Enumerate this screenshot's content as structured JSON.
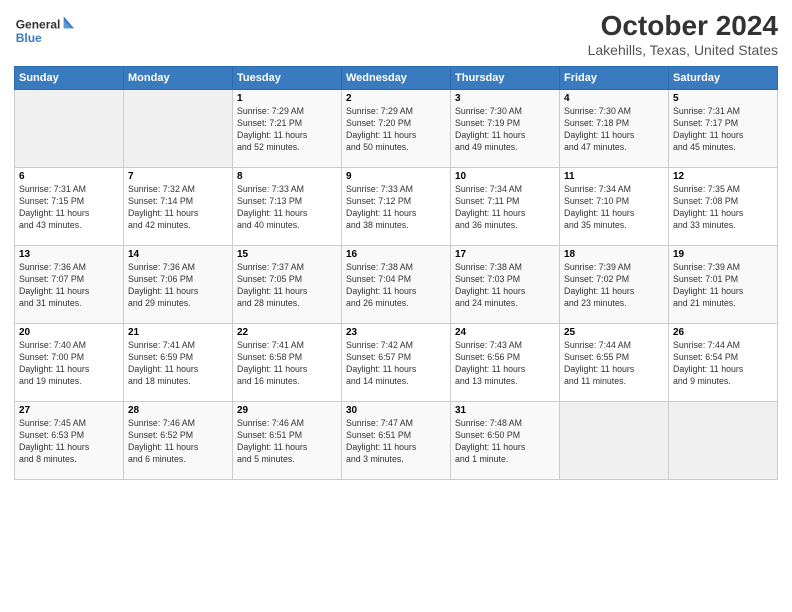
{
  "logo": {
    "line1": "General",
    "line2": "Blue"
  },
  "title": "October 2024",
  "subtitle": "Lakehills, Texas, United States",
  "headers": [
    "Sunday",
    "Monday",
    "Tuesday",
    "Wednesday",
    "Thursday",
    "Friday",
    "Saturday"
  ],
  "weeks": [
    [
      {
        "num": "",
        "info": ""
      },
      {
        "num": "",
        "info": ""
      },
      {
        "num": "1",
        "info": "Sunrise: 7:29 AM\nSunset: 7:21 PM\nDaylight: 11 hours\nand 52 minutes."
      },
      {
        "num": "2",
        "info": "Sunrise: 7:29 AM\nSunset: 7:20 PM\nDaylight: 11 hours\nand 50 minutes."
      },
      {
        "num": "3",
        "info": "Sunrise: 7:30 AM\nSunset: 7:19 PM\nDaylight: 11 hours\nand 49 minutes."
      },
      {
        "num": "4",
        "info": "Sunrise: 7:30 AM\nSunset: 7:18 PM\nDaylight: 11 hours\nand 47 minutes."
      },
      {
        "num": "5",
        "info": "Sunrise: 7:31 AM\nSunset: 7:17 PM\nDaylight: 11 hours\nand 45 minutes."
      }
    ],
    [
      {
        "num": "6",
        "info": "Sunrise: 7:31 AM\nSunset: 7:15 PM\nDaylight: 11 hours\nand 43 minutes."
      },
      {
        "num": "7",
        "info": "Sunrise: 7:32 AM\nSunset: 7:14 PM\nDaylight: 11 hours\nand 42 minutes."
      },
      {
        "num": "8",
        "info": "Sunrise: 7:33 AM\nSunset: 7:13 PM\nDaylight: 11 hours\nand 40 minutes."
      },
      {
        "num": "9",
        "info": "Sunrise: 7:33 AM\nSunset: 7:12 PM\nDaylight: 11 hours\nand 38 minutes."
      },
      {
        "num": "10",
        "info": "Sunrise: 7:34 AM\nSunset: 7:11 PM\nDaylight: 11 hours\nand 36 minutes."
      },
      {
        "num": "11",
        "info": "Sunrise: 7:34 AM\nSunset: 7:10 PM\nDaylight: 11 hours\nand 35 minutes."
      },
      {
        "num": "12",
        "info": "Sunrise: 7:35 AM\nSunset: 7:08 PM\nDaylight: 11 hours\nand 33 minutes."
      }
    ],
    [
      {
        "num": "13",
        "info": "Sunrise: 7:36 AM\nSunset: 7:07 PM\nDaylight: 11 hours\nand 31 minutes."
      },
      {
        "num": "14",
        "info": "Sunrise: 7:36 AM\nSunset: 7:06 PM\nDaylight: 11 hours\nand 29 minutes."
      },
      {
        "num": "15",
        "info": "Sunrise: 7:37 AM\nSunset: 7:05 PM\nDaylight: 11 hours\nand 28 minutes."
      },
      {
        "num": "16",
        "info": "Sunrise: 7:38 AM\nSunset: 7:04 PM\nDaylight: 11 hours\nand 26 minutes."
      },
      {
        "num": "17",
        "info": "Sunrise: 7:38 AM\nSunset: 7:03 PM\nDaylight: 11 hours\nand 24 minutes."
      },
      {
        "num": "18",
        "info": "Sunrise: 7:39 AM\nSunset: 7:02 PM\nDaylight: 11 hours\nand 23 minutes."
      },
      {
        "num": "19",
        "info": "Sunrise: 7:39 AM\nSunset: 7:01 PM\nDaylight: 11 hours\nand 21 minutes."
      }
    ],
    [
      {
        "num": "20",
        "info": "Sunrise: 7:40 AM\nSunset: 7:00 PM\nDaylight: 11 hours\nand 19 minutes."
      },
      {
        "num": "21",
        "info": "Sunrise: 7:41 AM\nSunset: 6:59 PM\nDaylight: 11 hours\nand 18 minutes."
      },
      {
        "num": "22",
        "info": "Sunrise: 7:41 AM\nSunset: 6:58 PM\nDaylight: 11 hours\nand 16 minutes."
      },
      {
        "num": "23",
        "info": "Sunrise: 7:42 AM\nSunset: 6:57 PM\nDaylight: 11 hours\nand 14 minutes."
      },
      {
        "num": "24",
        "info": "Sunrise: 7:43 AM\nSunset: 6:56 PM\nDaylight: 11 hours\nand 13 minutes."
      },
      {
        "num": "25",
        "info": "Sunrise: 7:44 AM\nSunset: 6:55 PM\nDaylight: 11 hours\nand 11 minutes."
      },
      {
        "num": "26",
        "info": "Sunrise: 7:44 AM\nSunset: 6:54 PM\nDaylight: 11 hours\nand 9 minutes."
      }
    ],
    [
      {
        "num": "27",
        "info": "Sunrise: 7:45 AM\nSunset: 6:53 PM\nDaylight: 11 hours\nand 8 minutes."
      },
      {
        "num": "28",
        "info": "Sunrise: 7:46 AM\nSunset: 6:52 PM\nDaylight: 11 hours\nand 6 minutes."
      },
      {
        "num": "29",
        "info": "Sunrise: 7:46 AM\nSunset: 6:51 PM\nDaylight: 11 hours\nand 5 minutes."
      },
      {
        "num": "30",
        "info": "Sunrise: 7:47 AM\nSunset: 6:51 PM\nDaylight: 11 hours\nand 3 minutes."
      },
      {
        "num": "31",
        "info": "Sunrise: 7:48 AM\nSunset: 6:50 PM\nDaylight: 11 hours\nand 1 minute."
      },
      {
        "num": "",
        "info": ""
      },
      {
        "num": "",
        "info": ""
      }
    ]
  ]
}
